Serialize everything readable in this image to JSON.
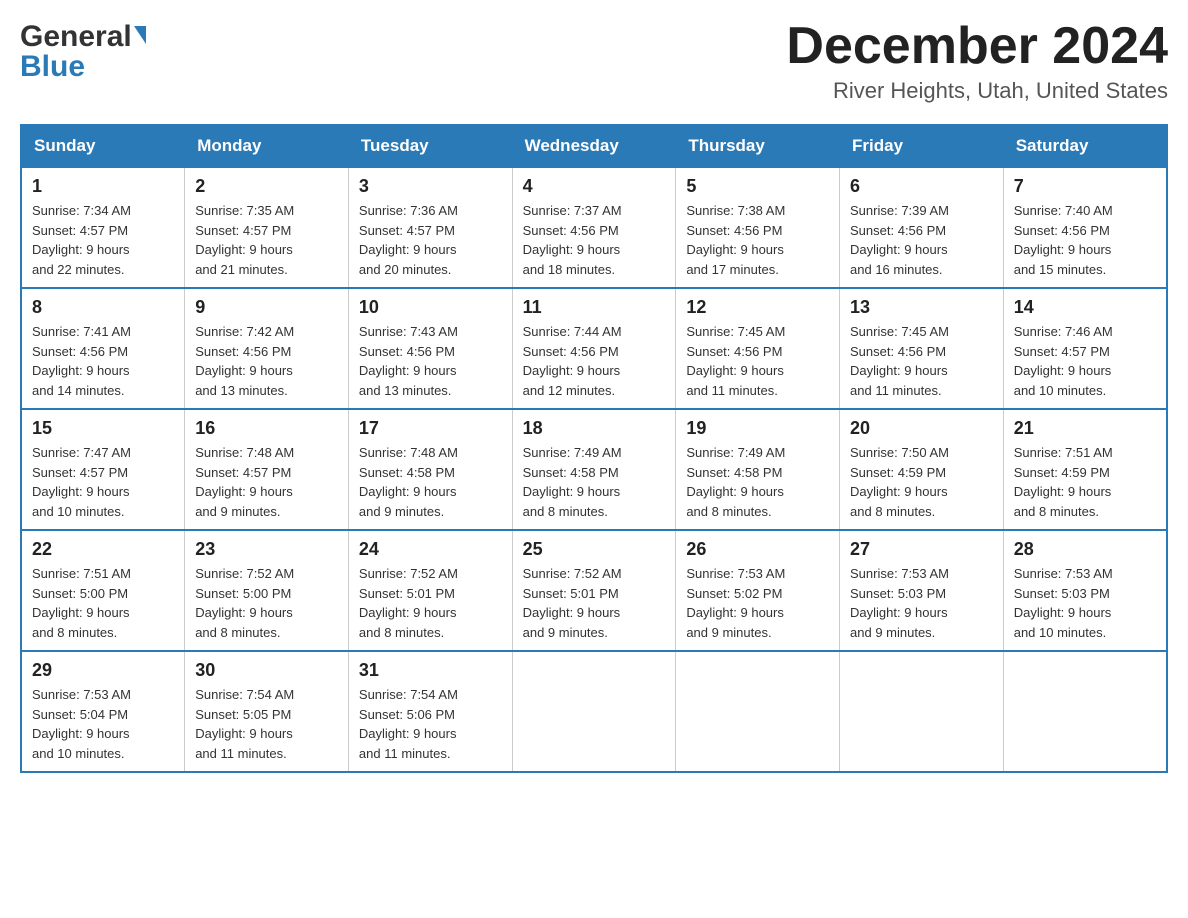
{
  "header": {
    "logo_general": "General",
    "logo_blue": "Blue",
    "month_title": "December 2024",
    "location": "River Heights, Utah, United States"
  },
  "days_of_week": [
    "Sunday",
    "Monday",
    "Tuesday",
    "Wednesday",
    "Thursday",
    "Friday",
    "Saturday"
  ],
  "weeks": [
    [
      {
        "day": "1",
        "sunrise": "7:34 AM",
        "sunset": "4:57 PM",
        "daylight": "9 hours and 22 minutes."
      },
      {
        "day": "2",
        "sunrise": "7:35 AM",
        "sunset": "4:57 PM",
        "daylight": "9 hours and 21 minutes."
      },
      {
        "day": "3",
        "sunrise": "7:36 AM",
        "sunset": "4:57 PM",
        "daylight": "9 hours and 20 minutes."
      },
      {
        "day": "4",
        "sunrise": "7:37 AM",
        "sunset": "4:56 PM",
        "daylight": "9 hours and 18 minutes."
      },
      {
        "day": "5",
        "sunrise": "7:38 AM",
        "sunset": "4:56 PM",
        "daylight": "9 hours and 17 minutes."
      },
      {
        "day": "6",
        "sunrise": "7:39 AM",
        "sunset": "4:56 PM",
        "daylight": "9 hours and 16 minutes."
      },
      {
        "day": "7",
        "sunrise": "7:40 AM",
        "sunset": "4:56 PM",
        "daylight": "9 hours and 15 minutes."
      }
    ],
    [
      {
        "day": "8",
        "sunrise": "7:41 AM",
        "sunset": "4:56 PM",
        "daylight": "9 hours and 14 minutes."
      },
      {
        "day": "9",
        "sunrise": "7:42 AM",
        "sunset": "4:56 PM",
        "daylight": "9 hours and 13 minutes."
      },
      {
        "day": "10",
        "sunrise": "7:43 AM",
        "sunset": "4:56 PM",
        "daylight": "9 hours and 13 minutes."
      },
      {
        "day": "11",
        "sunrise": "7:44 AM",
        "sunset": "4:56 PM",
        "daylight": "9 hours and 12 minutes."
      },
      {
        "day": "12",
        "sunrise": "7:45 AM",
        "sunset": "4:56 PM",
        "daylight": "9 hours and 11 minutes."
      },
      {
        "day": "13",
        "sunrise": "7:45 AM",
        "sunset": "4:56 PM",
        "daylight": "9 hours and 11 minutes."
      },
      {
        "day": "14",
        "sunrise": "7:46 AM",
        "sunset": "4:57 PM",
        "daylight": "9 hours and 10 minutes."
      }
    ],
    [
      {
        "day": "15",
        "sunrise": "7:47 AM",
        "sunset": "4:57 PM",
        "daylight": "9 hours and 10 minutes."
      },
      {
        "day": "16",
        "sunrise": "7:48 AM",
        "sunset": "4:57 PM",
        "daylight": "9 hours and 9 minutes."
      },
      {
        "day": "17",
        "sunrise": "7:48 AM",
        "sunset": "4:58 PM",
        "daylight": "9 hours and 9 minutes."
      },
      {
        "day": "18",
        "sunrise": "7:49 AM",
        "sunset": "4:58 PM",
        "daylight": "9 hours and 8 minutes."
      },
      {
        "day": "19",
        "sunrise": "7:49 AM",
        "sunset": "4:58 PM",
        "daylight": "9 hours and 8 minutes."
      },
      {
        "day": "20",
        "sunrise": "7:50 AM",
        "sunset": "4:59 PM",
        "daylight": "9 hours and 8 minutes."
      },
      {
        "day": "21",
        "sunrise": "7:51 AM",
        "sunset": "4:59 PM",
        "daylight": "9 hours and 8 minutes."
      }
    ],
    [
      {
        "day": "22",
        "sunrise": "7:51 AM",
        "sunset": "5:00 PM",
        "daylight": "9 hours and 8 minutes."
      },
      {
        "day": "23",
        "sunrise": "7:52 AM",
        "sunset": "5:00 PM",
        "daylight": "9 hours and 8 minutes."
      },
      {
        "day": "24",
        "sunrise": "7:52 AM",
        "sunset": "5:01 PM",
        "daylight": "9 hours and 8 minutes."
      },
      {
        "day": "25",
        "sunrise": "7:52 AM",
        "sunset": "5:01 PM",
        "daylight": "9 hours and 9 minutes."
      },
      {
        "day": "26",
        "sunrise": "7:53 AM",
        "sunset": "5:02 PM",
        "daylight": "9 hours and 9 minutes."
      },
      {
        "day": "27",
        "sunrise": "7:53 AM",
        "sunset": "5:03 PM",
        "daylight": "9 hours and 9 minutes."
      },
      {
        "day": "28",
        "sunrise": "7:53 AM",
        "sunset": "5:03 PM",
        "daylight": "9 hours and 10 minutes."
      }
    ],
    [
      {
        "day": "29",
        "sunrise": "7:53 AM",
        "sunset": "5:04 PM",
        "daylight": "9 hours and 10 minutes."
      },
      {
        "day": "30",
        "sunrise": "7:54 AM",
        "sunset": "5:05 PM",
        "daylight": "9 hours and 11 minutes."
      },
      {
        "day": "31",
        "sunrise": "7:54 AM",
        "sunset": "5:06 PM",
        "daylight": "9 hours and 11 minutes."
      },
      null,
      null,
      null,
      null
    ]
  ],
  "labels": {
    "sunrise": "Sunrise:",
    "sunset": "Sunset:",
    "daylight": "Daylight: 9 hours"
  }
}
